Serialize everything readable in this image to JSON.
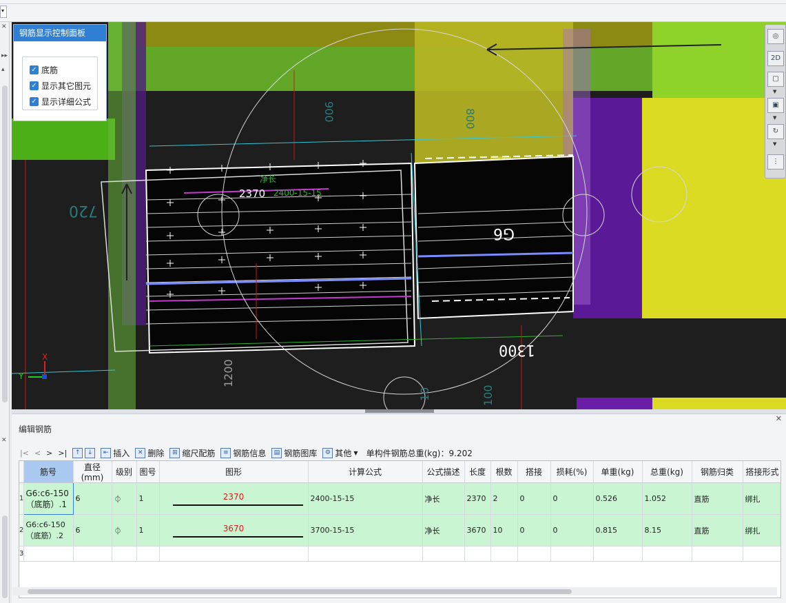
{
  "control_panel": {
    "title": "钢筋显示控制面板",
    "options": [
      {
        "label": "底筋",
        "checked": true
      },
      {
        "label": "显示其它图元",
        "checked": true
      },
      {
        "label": "显示详细公式",
        "checked": true
      }
    ]
  },
  "viewport": {
    "annotations": {
      "length_label": "2370",
      "net_length_label": "净长",
      "formula_overlay": "2400-15-15",
      "rebar_tag": "G6",
      "dim_1300": "1300",
      "dim_1200": "1200",
      "dim_800": "800",
      "dim_900": "900",
      "dim_720": "720",
      "dim_100": "100",
      "dim_10": "10",
      "axis_x": "X",
      "axis_y": "Y"
    }
  },
  "right_toolbar": {
    "buttons": [
      {
        "name": "orbit",
        "label": "◎"
      },
      {
        "name": "view-2d",
        "label": "2D"
      },
      {
        "name": "view-3d-box",
        "label": "▢"
      },
      {
        "name": "view-cube",
        "label": "▣"
      },
      {
        "name": "rotate",
        "label": "↻"
      },
      {
        "name": "settings",
        "label": "⋮"
      }
    ]
  },
  "edit_panel": {
    "title": "编辑钢筋",
    "toolbar": {
      "nav": [
        "|<",
        "<",
        ">",
        ">|"
      ],
      "insert": "插入",
      "delete": "删除",
      "scale": "缩尺配筋",
      "info": "钢筋信息",
      "library": "钢筋图库",
      "other": "其他",
      "total": "单构件钢筋总重(kg)：9.202"
    },
    "columns": [
      "筋号",
      "直径(mm)",
      "级别",
      "图号",
      "图形",
      "计算公式",
      "公式描述",
      "长度",
      "根数",
      "搭接",
      "损耗(%)",
      "单重(kg)",
      "总重(kg)",
      "钢筋归类",
      "搭接形式"
    ],
    "rows": [
      {
        "no": "1",
        "jinhao": "G6:c6-150（底筋）.1",
        "diameter": "6",
        "grade": "⏀",
        "figure_no": "1",
        "shape_value": "2370",
        "formula": "2400-15-15",
        "formula_desc": "净长",
        "length": "2370",
        "count": "2",
        "lap": "0",
        "loss": "0",
        "unit_weight": "0.526",
        "total_weight": "1.052",
        "category": "直筋",
        "lap_type": "绑扎"
      },
      {
        "no": "2",
        "jinhao": "G6:c6-150（底筋）.2",
        "diameter": "6",
        "grade": "⏀",
        "figure_no": "1",
        "shape_value": "3670",
        "formula": "3700-15-15",
        "formula_desc": "净长",
        "length": "3670",
        "count": "10",
        "lap": "0",
        "loss": "0",
        "unit_weight": "0.815",
        "total_weight": "8.15",
        "category": "直筋",
        "lap_type": "绑扎"
      }
    ],
    "empty_row_no": "3"
  },
  "colors": {
    "accent": "#2f7fd4",
    "row_green": "#c9f5d3",
    "shape_red": "#d42020",
    "cad_yellow": "#d9d820",
    "cad_green": "#7fd21a",
    "cad_purple": "#6a1ea8"
  }
}
